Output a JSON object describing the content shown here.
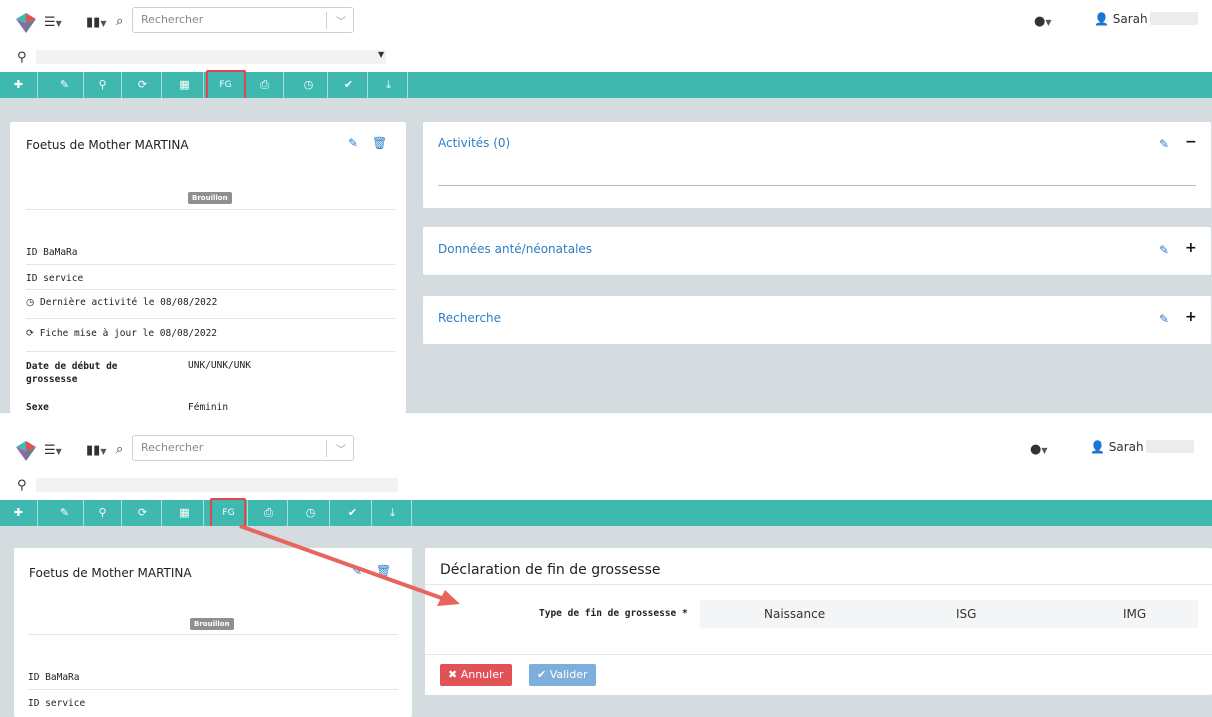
{
  "search": {
    "placeholder": "Rechercher"
  },
  "header": {
    "user_name": "Sarah"
  },
  "toolbar": {
    "buttons": [
      {
        "name": "add",
        "glyph": "✚"
      },
      {
        "name": "edit",
        "glyph": "✎"
      },
      {
        "name": "location",
        "glyph": "⚲"
      },
      {
        "name": "refresh",
        "glyph": "⟳"
      },
      {
        "name": "calendar",
        "glyph": "▦"
      },
      {
        "name": "fg",
        "glyph": "FG"
      },
      {
        "name": "print",
        "glyph": "⎙"
      },
      {
        "name": "history",
        "glyph": "◷"
      },
      {
        "name": "validate",
        "glyph": "✔"
      },
      {
        "name": "download",
        "glyph": "⤓"
      }
    ]
  },
  "patient": {
    "name": "Foetus de Mother MARTINA",
    "status": "Brouillon",
    "id_bamara_label": "ID BaMaRa",
    "id_service_label": "ID service",
    "last_activity": "Dernière activité le 08/08/2022",
    "updated": "Fiche mise à jour le 08/08/2022",
    "pregnancy_start_label": "Date de début de grossesse",
    "pregnancy_start_value": "UNK/UNK/UNK",
    "sex_label": "Sexe",
    "sex_value": "Féminin"
  },
  "panels": {
    "activities": "Activités (0)",
    "antenatal": "Données anté/néonatales",
    "research": "Recherche"
  },
  "declaration": {
    "title": "Déclaration de fin de grossesse",
    "type_label": "Type de fin de grossesse *",
    "options": [
      "Naissance",
      "ISG",
      "IMG"
    ],
    "cancel": "Annuler",
    "validate": "Valider"
  },
  "colors": {
    "toolbar": "#3fb8b0",
    "accent": "#2a7ec7",
    "highlight": "#e0474c",
    "cancel": "#e05256",
    "validate": "#7eaedb"
  },
  "icons": {
    "menu": "list-icon",
    "stats": "bar-chart-icon",
    "search": "search-icon",
    "help": "help-icon",
    "user": "user-icon",
    "location": "map-marker-icon",
    "edit": "pencil-icon",
    "delete": "trash-icon"
  }
}
